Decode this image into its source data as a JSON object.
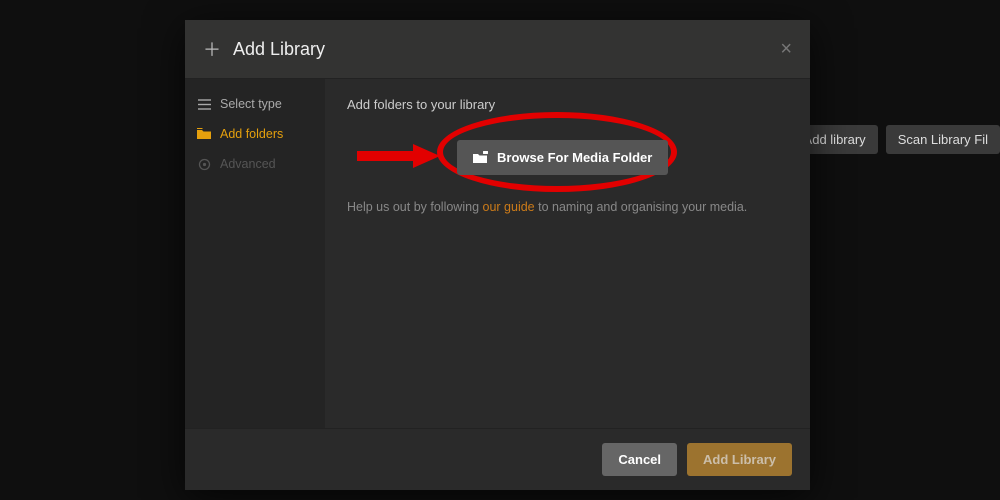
{
  "backdrop": {
    "add_library": "Add library",
    "scan_library": "Scan Library Fil"
  },
  "modal": {
    "title": "Add Library",
    "close": "×"
  },
  "sidebar": {
    "items": [
      {
        "label": "Select type"
      },
      {
        "label": "Add folders"
      },
      {
        "label": "Advanced"
      }
    ]
  },
  "content": {
    "heading": "Add folders to your library",
    "browse_label": "Browse For Media Folder",
    "help_prefix": "Help us out by following ",
    "help_link": "our guide",
    "help_suffix": " to naming and organising your media."
  },
  "footer": {
    "cancel": "Cancel",
    "add": "Add Library"
  }
}
